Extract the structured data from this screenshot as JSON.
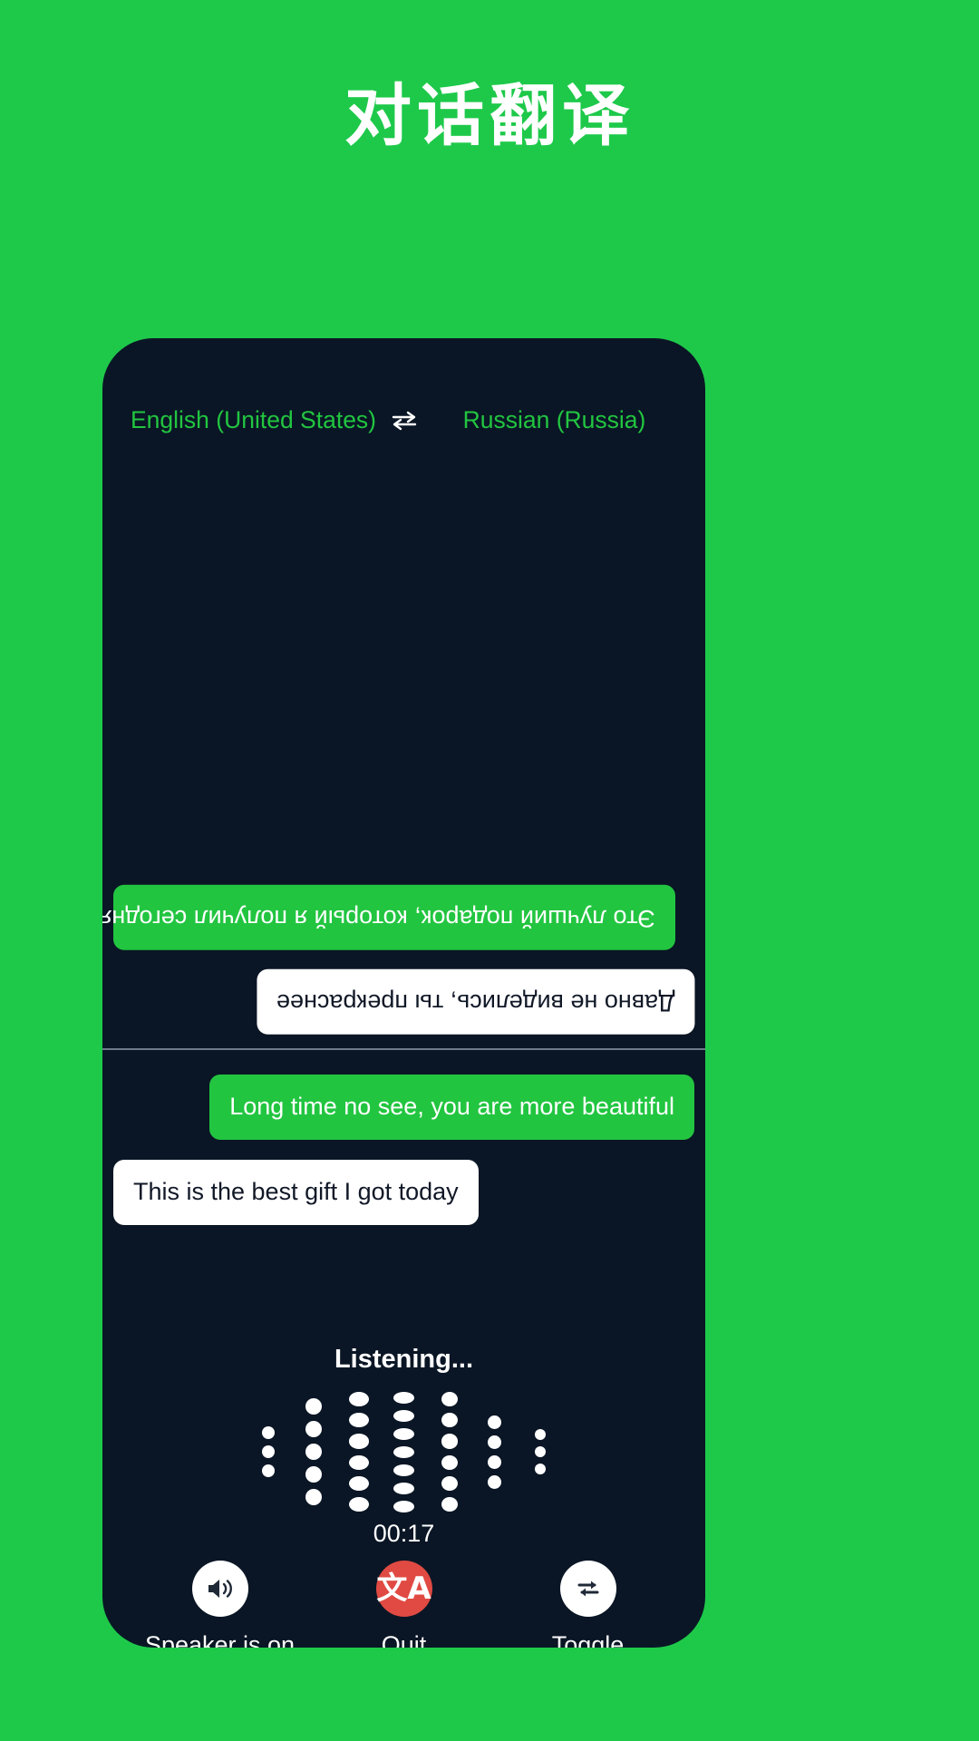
{
  "page": {
    "title": "对话翻译",
    "background_color": "#1ec94a",
    "card_color": "#0a1625",
    "accent_green": "#22c540",
    "quit_red": "#e04a42"
  },
  "language_bar": {
    "source": "English (United States)",
    "target": "Russian (Russia)",
    "swap_icon": "swap-horizontal-icon"
  },
  "conversation": {
    "top_panel_messages": [
      {
        "text": "Это лучший подарок, который я получил сегодня",
        "style": "green",
        "align": "left",
        "rotated": true
      },
      {
        "text": "Давно не виделись, ты прекраснее",
        "style": "white",
        "align": "right",
        "rotated": true
      }
    ],
    "bottom_panel_messages": [
      {
        "text": "Long time no see, you are more beautiful",
        "style": "green",
        "align": "right",
        "rotated": false
      },
      {
        "text": "This is the best gift I got today",
        "style": "white",
        "align": "left",
        "rotated": false
      }
    ]
  },
  "status": {
    "listening_label": "Listening...",
    "timer": "00:17"
  },
  "visualizer": {
    "columns": [
      {
        "count": 3,
        "size": 14
      },
      {
        "count": 5,
        "size": 18
      },
      {
        "count": 6,
        "size": 22
      },
      {
        "count": 7,
        "size": 23
      },
      {
        "count": 6,
        "size": 18
      },
      {
        "count": 4,
        "size": 15
      },
      {
        "count": 3,
        "size": 12
      }
    ]
  },
  "controls": [
    {
      "id": "speaker",
      "label": "Speaker is on",
      "icon": "speaker-on-icon",
      "circle_color": "#ffffff",
      "icon_color": "#1f2937"
    },
    {
      "id": "quit",
      "label": "Quit",
      "icon": "translate-icon",
      "circle_color": "#e04a42",
      "icon_color": "#ffffff",
      "glyph": "文A"
    },
    {
      "id": "toggle",
      "label": "Toggle",
      "icon": "repeat-arrows-icon",
      "circle_color": "#ffffff",
      "icon_color": "#1f2937"
    }
  ]
}
